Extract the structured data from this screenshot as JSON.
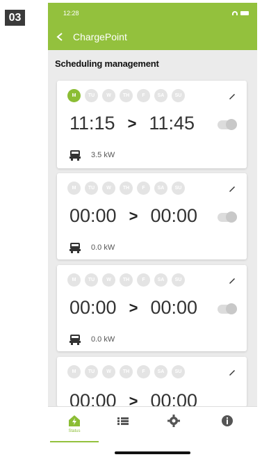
{
  "step_label": "03",
  "status_bar": {
    "time": "12:28"
  },
  "app_bar": {
    "title": "ChargePoint"
  },
  "section_title": "Scheduling management",
  "schedules": [
    {
      "days": [
        "M",
        "TU",
        "W",
        "TH",
        "F",
        "SA",
        "SU"
      ],
      "active_day_index": 0,
      "start": "11:15",
      "end": "11:45",
      "power": "3.5 kW",
      "enabled": false
    },
    {
      "days": [
        "M",
        "TU",
        "W",
        "TH",
        "F",
        "SA",
        "SU"
      ],
      "active_day_index": -1,
      "start": "00:00",
      "end": "00:00",
      "power": "0.0 kW",
      "enabled": false
    },
    {
      "days": [
        "M",
        "TU",
        "W",
        "TH",
        "F",
        "SA",
        "SU"
      ],
      "active_day_index": -1,
      "start": "00:00",
      "end": "00:00",
      "power": "0.0 kW",
      "enabled": false
    },
    {
      "days": [
        "M",
        "TU",
        "W",
        "TH",
        "F",
        "SA",
        "SU"
      ],
      "active_day_index": -1,
      "start": "00:00",
      "end": "00:00",
      "power": "",
      "enabled": false
    }
  ],
  "bottom_nav": {
    "items": [
      {
        "icon": "home-charger-icon",
        "label": "Status",
        "active": true
      },
      {
        "icon": "list-icon",
        "label": "",
        "active": false
      },
      {
        "icon": "gear-icon",
        "label": "",
        "active": false
      },
      {
        "icon": "info-icon",
        "label": "",
        "active": false
      }
    ]
  },
  "colors": {
    "brand_green": "#93c13d",
    "active_day": "#8bbd34"
  }
}
